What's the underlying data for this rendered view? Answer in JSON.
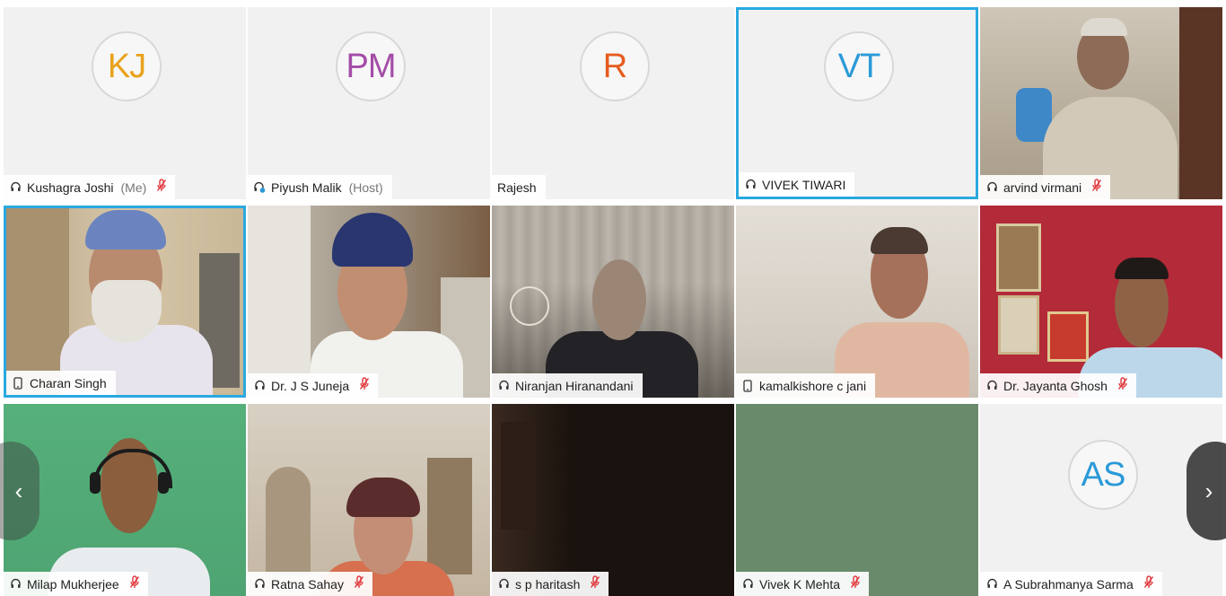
{
  "participants": [
    {
      "initials": "KJ",
      "name": "Kushagra Joshi",
      "tag": "(Me)",
      "initials_color": "#e9a21c",
      "muted": true
    },
    {
      "initials": "PM",
      "name": "Piyush Malik",
      "tag": "(Host)",
      "initials_color": "#a44ca8",
      "muted": false
    },
    {
      "initials": "R",
      "name": "Rajesh",
      "initials_color": "#e65c1e",
      "muted": false
    },
    {
      "initials": "VT",
      "name": "VIVEK TIWARI",
      "initials_color": "#2a9ad8",
      "muted": false
    },
    {
      "name": "arvind virmani",
      "muted": true
    },
    {
      "name": "Charan Singh",
      "muted": false
    },
    {
      "name": "Dr. J S Juneja",
      "muted": true
    },
    {
      "name": "Niranjan Hiranandani",
      "muted": false
    },
    {
      "name": "kamalkishore c jani",
      "muted": false
    },
    {
      "name": "Dr. Jayanta Ghosh",
      "muted": true
    },
    {
      "name": "Milap Mukherjee",
      "muted": true
    },
    {
      "name": "Ratna Sahay",
      "muted": true
    },
    {
      "name": "s p haritash",
      "muted": true
    },
    {
      "name": "Vivek K Mehta",
      "muted": true
    },
    {
      "initials": "AS",
      "name": "A Subrahmanya Sarma",
      "initials_color": "#2a9ad8",
      "muted": true
    }
  ],
  "icons": {
    "audio": "headset-icon",
    "host": "host-audio-icon",
    "phone": "phone-icon",
    "muted": "muted-mic-icon",
    "prev": "chevron-left-icon",
    "next": "chevron-right-icon"
  },
  "nav": {
    "prev_glyph": "‹",
    "next_glyph": "›"
  },
  "colors": {
    "active_border": "#2aa9e0",
    "muted": "#e0353a"
  }
}
